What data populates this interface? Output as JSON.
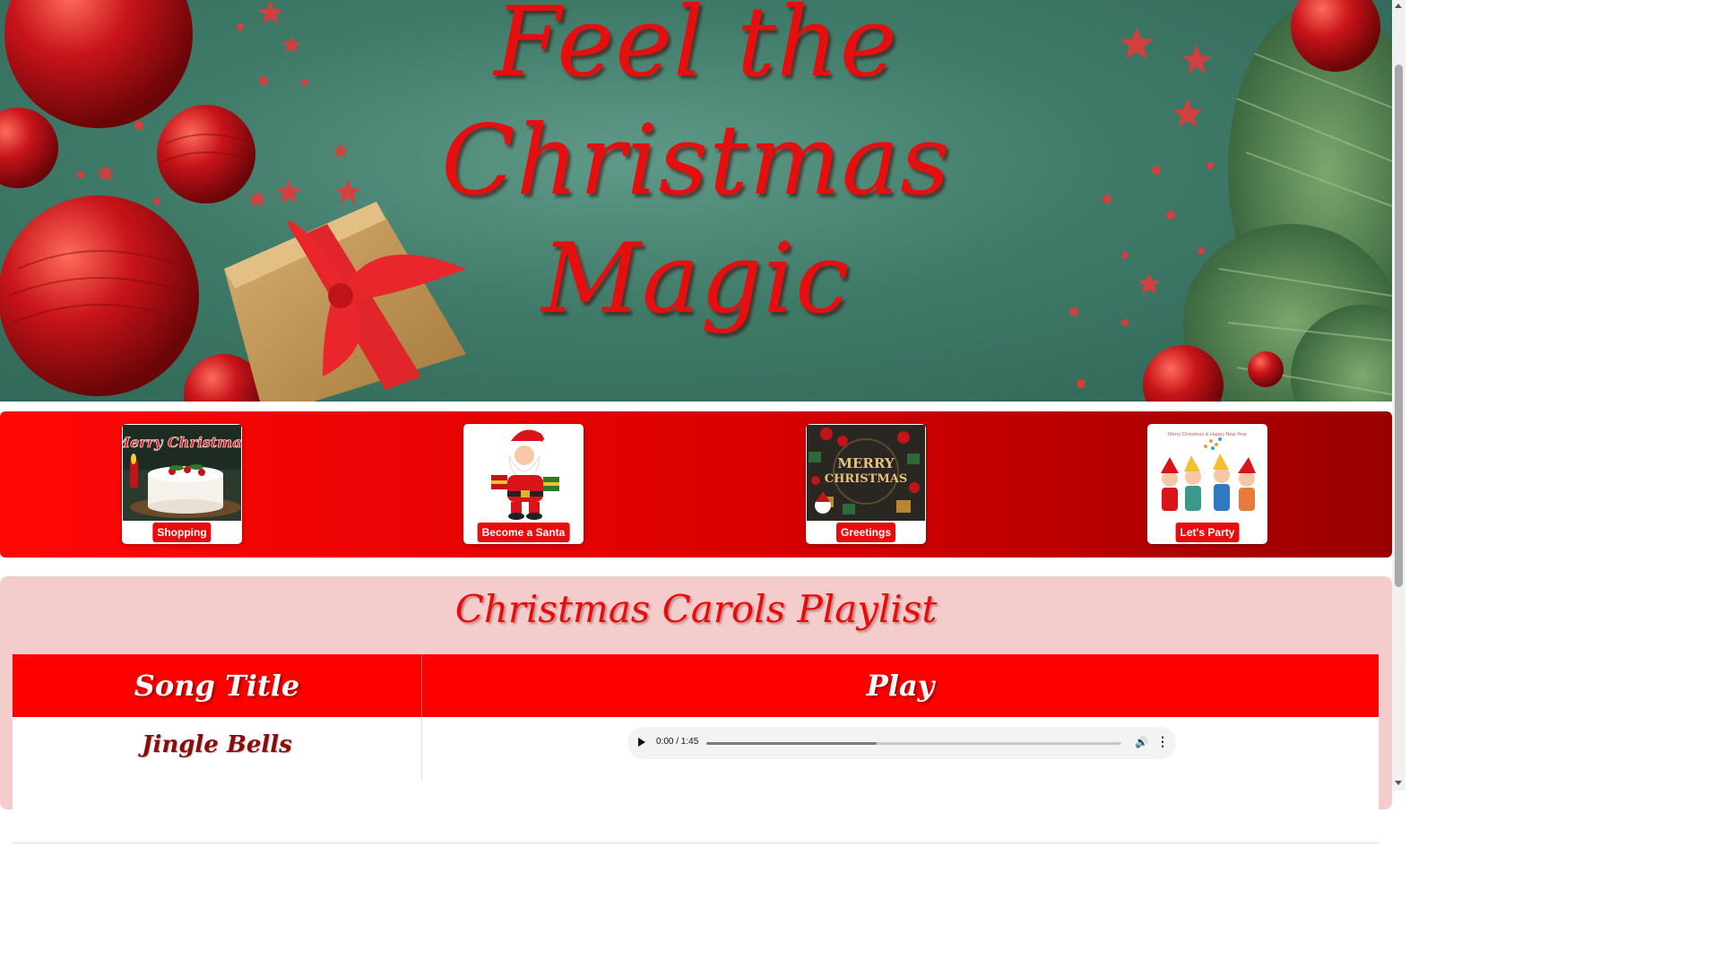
{
  "hero": {
    "title_lines": [
      "Feel the",
      "Christmas",
      "Magic"
    ]
  },
  "nav": {
    "cards": [
      {
        "label": "Shopping",
        "image": "christmas-cake"
      },
      {
        "label": "Become a Santa",
        "image": "santa-claus"
      },
      {
        "label": "Greetings",
        "image": "merry-christmas-ornaments"
      },
      {
        "label": "Let's Party",
        "image": "party-kids",
        "image_caption": "Merry Christmas & Happy New Year"
      }
    ],
    "cake_text": "Merry Christmas",
    "greeting_text_1": "MERRY",
    "greeting_text_2": "CHRISTMAS"
  },
  "playlist": {
    "title": "Christmas Carols Playlist",
    "columns": [
      "Song Title",
      "Play"
    ],
    "rows": [
      {
        "song": "Jingle Bells",
        "time": "0:00 / 1:45",
        "buffered": 0.41
      }
    ]
  },
  "colors": {
    "accent": "#e80c0c",
    "hero_green": "#3f7a68",
    "playlist_bg": "#f5cccc"
  }
}
